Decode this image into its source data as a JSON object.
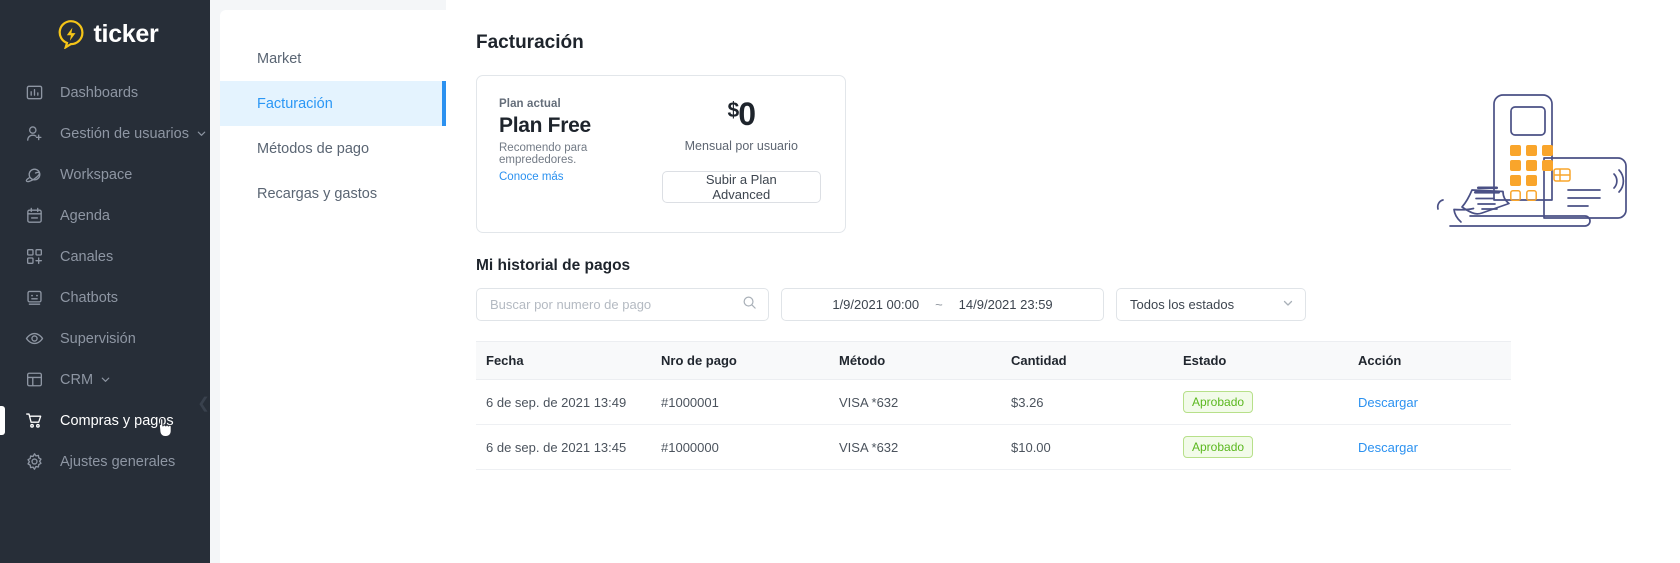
{
  "brand": {
    "name": "ticker",
    "logo_icon": "ticker-pin-icon",
    "logo_color": "#f5c518"
  },
  "sidebar": {
    "items": [
      {
        "label": "Dashboards",
        "icon": "chart-bars-icon",
        "active": false,
        "chevron": false
      },
      {
        "label": "Gestión de usuarios",
        "icon": "user-add-icon",
        "active": false,
        "chevron": true
      },
      {
        "label": "Workspace",
        "icon": "planet-icon",
        "active": false,
        "chevron": false
      },
      {
        "label": "Agenda",
        "icon": "calendar-icon",
        "active": false,
        "chevron": false
      },
      {
        "label": "Canales",
        "icon": "grid-add-icon",
        "active": false,
        "chevron": false
      },
      {
        "label": "Chatbots",
        "icon": "robot-face-icon",
        "active": false,
        "chevron": false
      },
      {
        "label": "Supervisión",
        "icon": "eye-icon",
        "active": false,
        "chevron": false
      },
      {
        "label": "CRM",
        "icon": "layout-icon",
        "active": false,
        "chevron": true
      },
      {
        "label": "Compras y pagos",
        "icon": "shopping-cart-icon",
        "active": true,
        "chevron": false
      },
      {
        "label": "Ajustes generales",
        "icon": "gear-icon",
        "active": false,
        "chevron": false
      }
    ],
    "collapse_icon": "chevron-left-icon"
  },
  "subnav": {
    "items": [
      {
        "label": "Market",
        "active": false
      },
      {
        "label": "Facturación",
        "active": true
      },
      {
        "label": "Métodos de pago",
        "active": false
      },
      {
        "label": "Recargas y gastos",
        "active": false
      }
    ],
    "active_color": "#2b97f5",
    "active_bg": "#e4f3fe"
  },
  "main": {
    "page_title": "Facturación",
    "plan_card": {
      "kicker": "Plan actual",
      "name": "Plan Free",
      "subtitle": "Recomendo para emprededores.",
      "link": "Conoce más",
      "currency": "$",
      "price": "0",
      "price_note": "Mensual por usuario",
      "upgrade_button": "Subir a Plan Advanced",
      "illustration_icon": "pos-terminal-receipt-card-illustration"
    },
    "history": {
      "section_title": "Mi historial de pagos",
      "search": {
        "placeholder": "Buscar por numero de pago",
        "value": "",
        "icon": "search-icon"
      },
      "date_range": {
        "from": "1/9/2021 00:00",
        "separator": "~",
        "to": "14/9/2021 23:59"
      },
      "status_filter": {
        "value": "Todos los estados",
        "icon": "chevron-down-icon"
      },
      "columns": [
        "Fecha",
        "Nro de pago",
        "Método",
        "Cantidad",
        "Estado",
        "Acción"
      ],
      "rows": [
        {
          "fecha": "6 de sep. de 2021 13:49",
          "nro": "#1000001",
          "metodo": "VISA *632",
          "cantidad": "$3.26",
          "estado": "Aprobado",
          "accion": "Descargar"
        },
        {
          "fecha": "6 de sep. de 2021 13:45",
          "nro": "#1000000",
          "metodo": "VISA *632",
          "cantidad": "$10.00",
          "estado": "Aprobado",
          "accion": "Descargar"
        }
      ]
    }
  }
}
